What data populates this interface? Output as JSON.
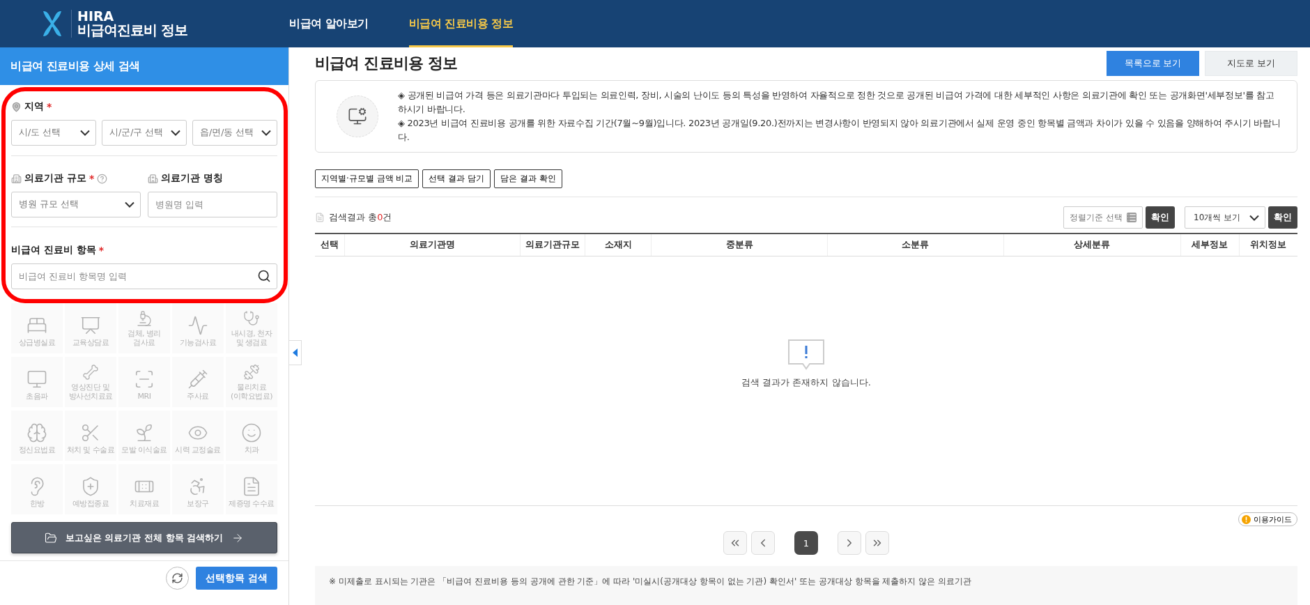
{
  "header": {
    "logo": {
      "title": "HIRA",
      "subtitle": "비급여진료비 정보"
    },
    "nav": [
      {
        "label": "비급여 알아보기",
        "selected": false
      },
      {
        "label": "비급여 진료비용 정보",
        "selected": true
      }
    ]
  },
  "sidebar": {
    "title": "비급여 진료비용 상세 검색",
    "highlighted": true,
    "region": {
      "label": "지역",
      "required_mark": "*",
      "selects": [
        "시/도 선택",
        "시/군/구 선택",
        "읍/면/동 선택"
      ]
    },
    "size": {
      "label": "의료기관 규모",
      "required_mark": "*",
      "select": "병원 규모 선택"
    },
    "name": {
      "label": "의료기관 명칭",
      "placeholder": "병원명 입력"
    },
    "item": {
      "label": "비급여 진료비 항목",
      "required_mark": "*",
      "placeholder": "비급여 진료비 항목명 입력"
    },
    "categories": [
      {
        "label": "상급병실료",
        "disabled": true
      },
      {
        "label": "교육상담료",
        "disabled": true
      },
      {
        "label": "검체, 병리\n검사료",
        "disabled": true
      },
      {
        "label": "기능검사료",
        "disabled": true
      },
      {
        "label": "내시경, 천자\n및 생검료",
        "disabled": true
      },
      {
        "label": "초음파",
        "disabled": true
      },
      {
        "label": "영상진단 및\n방사선치료료",
        "disabled": true
      },
      {
        "label": "MRI",
        "disabled": true
      },
      {
        "label": "주사료",
        "disabled": true
      },
      {
        "label": "물리치료\n(이학요법료)",
        "disabled": true
      },
      {
        "label": "정신요법료",
        "disabled": true
      },
      {
        "label": "처치 및 수술료",
        "disabled": true
      },
      {
        "label": "모발 이식술료",
        "disabled": true
      },
      {
        "label": "시력 교정술료",
        "disabled": true
      },
      {
        "label": "치과",
        "disabled": true
      },
      {
        "label": "한방",
        "disabled": true
      },
      {
        "label": "예방접종료",
        "disabled": true
      },
      {
        "label": "치료재료",
        "disabled": true
      },
      {
        "label": "보장구",
        "disabled": true
      },
      {
        "label": "제증명 수수료",
        "disabled": true
      }
    ],
    "all_search_button": "보고싶은 의료기관 전체 항목 검색하기",
    "search_button": "선택항목 검색"
  },
  "main": {
    "title": "비급여 진료비용 정보",
    "view_toggle": [
      {
        "label": "목록으로 보기",
        "selected": true
      },
      {
        "label": "지도로 보기",
        "selected": false
      }
    ],
    "notice": [
      "◈ 공개된 비급여 가격 등은 의료기관마다 투입되는 의료인력, 장비, 시술의 난이도 등의 특성을 반영하여 자율적으로 정한 것으로 공개된 비급여 가격에 대한 세부적인 사항은 의료기관에 확인 또는 공개화면'세부정보'를 참고하시기 바랍니다.",
      "◈ 2023년 비급여 진료비용 공개를 위한 자료수집 기간(7월~9월)입니다. 2023년 공개일(9.20.)전까지는 변경사항이 반영되지 않아 의료기관에서 실제 운영 중인 항목별 금액과 차이가 있을 수 있음을 양해하여 주시기 바랍니다."
    ],
    "actions": [
      "지역별·규모별 금액 비교",
      "선택 결과 담기",
      "담은 결과 확인"
    ],
    "result_count": {
      "prefix": "검색결과 총",
      "count": "0",
      "suffix": "건"
    },
    "sort": {
      "placeholder": "정렬기준 선택",
      "confirm": "확인"
    },
    "page_size": {
      "value": "10개씩 보기",
      "confirm": "확인"
    },
    "table": {
      "columns": [
        "선택",
        "의료기관명",
        "의료기관규모",
        "소재지",
        "중분류",
        "소분류",
        "상세분류",
        "세부정보",
        "위치정보"
      ]
    },
    "empty_message": "검색 결과가 존재하지 않습니다.",
    "guide_button": "이용가이드",
    "pagination": {
      "pages": [
        {
          "label": "1",
          "selected": true
        }
      ]
    },
    "footnote": "※ 미제출로 표시되는 기관은 「비급여 진료비용 등의 공개에 관한 기준」에 따라 '미실시(공개대상 항목이 없는 기관) 확인서' 또는 공개대상 항목을 제출하지 않은 의료기관"
  }
}
